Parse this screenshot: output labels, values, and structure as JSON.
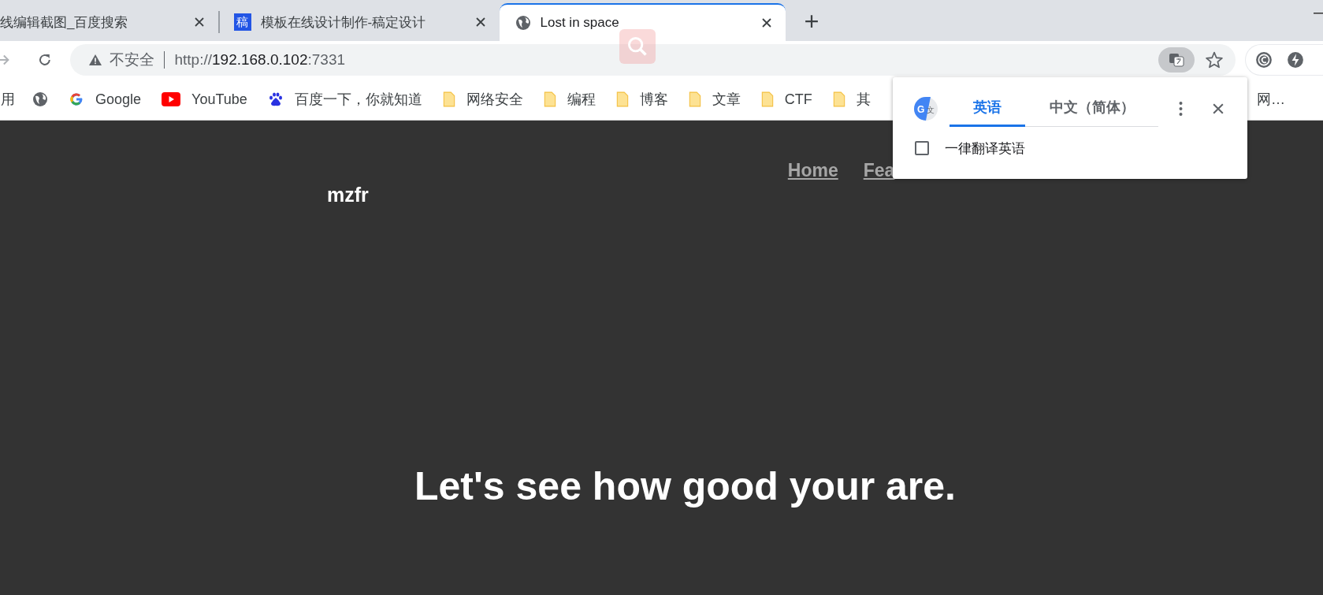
{
  "tabs": [
    {
      "title": "线编辑截图_百度搜索",
      "kind": "none",
      "selected": false
    },
    {
      "title": "模板在线设计制作-稿定设计",
      "kind": "badge",
      "badge": "稿",
      "selected": false
    },
    {
      "title": "Lost in space",
      "kind": "globe",
      "selected": true
    }
  ],
  "address_bar": {
    "security": "不安全",
    "url_scheme": "http://",
    "url_host": "192.168.0.102",
    "url_port": ":7331"
  },
  "bookmarks": [
    {
      "label": "用",
      "kind": "none"
    },
    {
      "kind": "globe"
    },
    {
      "label": "Google",
      "kind": "google"
    },
    {
      "label": "YouTube",
      "kind": "youtube"
    },
    {
      "label": "百度一下，你就知道",
      "kind": "baidu"
    },
    {
      "label": "网络安全",
      "kind": "folder"
    },
    {
      "label": "编程",
      "kind": "folder"
    },
    {
      "label": "博客",
      "kind": "folder"
    },
    {
      "label": "文章",
      "kind": "folder"
    },
    {
      "label": "CTF",
      "kind": "folder"
    },
    {
      "label": "其",
      "kind": "folder"
    }
  ],
  "bookmark_overflow": "网…",
  "page": {
    "brand": "mzfr",
    "nav": [
      "Home",
      "Fea"
    ],
    "headline": "Let's see how good your are."
  },
  "translate_popup": {
    "logo_letters": [
      "G",
      "文"
    ],
    "tabs": [
      {
        "label": "英语",
        "selected": true
      },
      {
        "label": "中文（简体）",
        "selected": false
      }
    ],
    "option": {
      "label": "一律翻译英语",
      "checked": false
    }
  }
}
